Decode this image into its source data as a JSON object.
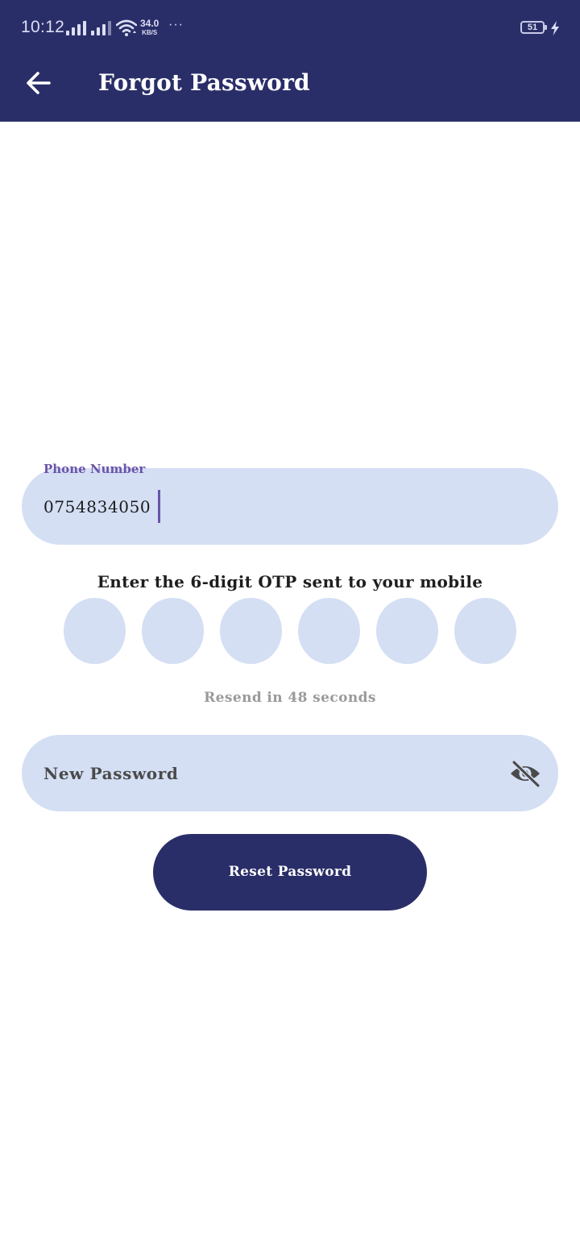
{
  "status_bar": {
    "time": "10:12",
    "net_speed": "34.0",
    "net_unit": "KB/S",
    "more": "···",
    "battery": "51"
  },
  "header": {
    "title": "Forgot Password"
  },
  "form": {
    "phone_label": "Phone Number",
    "phone_value": "0754834050",
    "otp_prompt": "Enter the 6-digit OTP sent to your mobile",
    "otp_digits": [
      "",
      "",
      "",
      "",
      "",
      ""
    ],
    "resend_text": "Resend in 48 seconds",
    "password_placeholder": "New Password",
    "reset_button_label": "Reset Password"
  },
  "colors": {
    "primary": "#2a2e68",
    "field_bg": "#d4dff4",
    "label_accent": "#6a54a8"
  }
}
